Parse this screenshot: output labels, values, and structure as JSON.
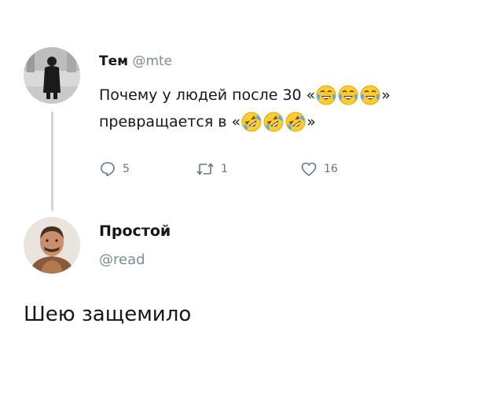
{
  "tweet": {
    "author_name": "Тем",
    "author_handle": "@mte",
    "text_line1_before": "Почему у людей после 30 «",
    "text_line1_after": "»",
    "text_line2_before": "превращается в «",
    "text_line2_after": "»",
    "emoji_line1": "face-with-tears-of-joy",
    "emoji_line2": "rolling-on-the-floor-laughing",
    "replies_count": "5",
    "retweets_count": "1",
    "likes_count": "16"
  },
  "reply": {
    "author_name": "Простой",
    "author_handle": "@read",
    "text": "Шею защемило"
  },
  "colors": {
    "text": "#14171a",
    "muted": "#7d8b97",
    "icon": "#657786",
    "thread_line": "#cfd6dc",
    "emoji_yellow": "#ffcc33",
    "emoji_tears": "#5dadec"
  }
}
